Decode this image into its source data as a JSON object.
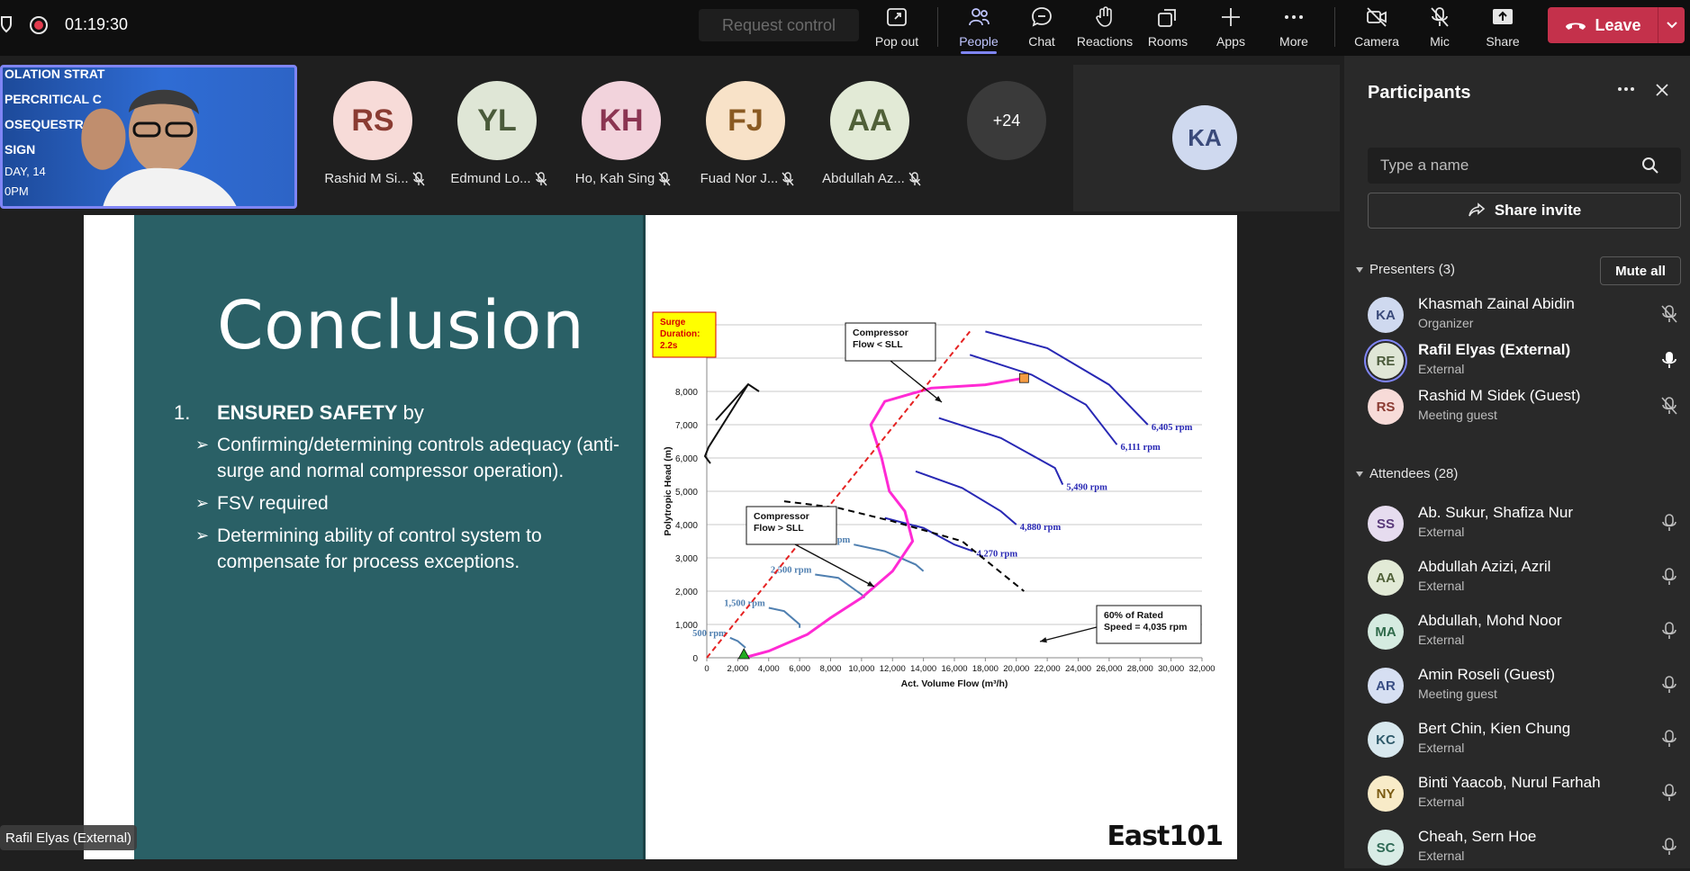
{
  "toolbar": {
    "timer": "01:19:30",
    "request_control": "Request control",
    "buttons": {
      "pop_out": "Pop out",
      "people": "People",
      "chat": "Chat",
      "reactions": "Reactions",
      "rooms": "Rooms",
      "apps": "Apps",
      "more": "More",
      "camera": "Camera",
      "mic": "Mic",
      "share": "Share"
    },
    "leave": "Leave"
  },
  "gallery": {
    "tiles": [
      {
        "initials": "RS",
        "name": "Rashid M Si...",
        "bg": "#f7dbd8",
        "fg": "#8a3b32"
      },
      {
        "initials": "YL",
        "name": "Edmund Lo...",
        "bg": "#dfe6d6",
        "fg": "#4a5a3a"
      },
      {
        "initials": "KH",
        "name": "Ho, Kah Sing",
        "bg": "#f2d3dc",
        "fg": "#8b3552"
      },
      {
        "initials": "FJ",
        "name": "Fuad Nor J...",
        "bg": "#f8e2c8",
        "fg": "#8a5a22"
      },
      {
        "initials": "AA",
        "name": "Abdullah Az...",
        "bg": "#e2ead6",
        "fg": "#506038"
      }
    ],
    "overflow": "+24",
    "speaker_tile_initials": "KA"
  },
  "slide": {
    "title": "Conclusion",
    "item_number": "1.",
    "item_heading": "ENSURED SAFETY",
    "item_heading_suffix": " by",
    "subitems": [
      "Confirming/determining controls adequacy (anti-surge and normal compressor operation).",
      "FSV required",
      "Determining ability of control system to compensate for process exceptions."
    ],
    "brand": "East101"
  },
  "chart_data": {
    "type": "line",
    "title": "",
    "xlabel": "Act. Volume Flow (m³/h)",
    "ylabel": "Polytropic Head (m)",
    "xlim": [
      0,
      32000
    ],
    "ylim": [
      0,
      10000
    ],
    "x_ticks": [
      "0",
      "2,000",
      "4,000",
      "6,000",
      "8,000",
      "10,000",
      "12,000",
      "14,000",
      "16,000",
      "18,000",
      "20,000",
      "22,000",
      "24,000",
      "26,000",
      "28,000",
      "30,000",
      "32,000"
    ],
    "y_ticks": [
      "0",
      "1,000",
      "2,000",
      "3,000",
      "4,000",
      "5,000",
      "6,000",
      "7,000",
      "8,000"
    ],
    "grid": true,
    "series": [
      {
        "name": "6,405 rpm",
        "color": "#2828b4",
        "points": [
          [
            18000,
            9800
          ],
          [
            22000,
            9300
          ],
          [
            26000,
            8200
          ],
          [
            28500,
            7000
          ]
        ]
      },
      {
        "name": "6,111 rpm",
        "color": "#2828b4",
        "points": [
          [
            17000,
            9100
          ],
          [
            21000,
            8500
          ],
          [
            24500,
            7600
          ],
          [
            26500,
            6400
          ]
        ]
      },
      {
        "name": "5,490 rpm",
        "color": "#2828b4",
        "points": [
          [
            15000,
            7200
          ],
          [
            19000,
            6600
          ],
          [
            22500,
            5700
          ],
          [
            23000,
            5200
          ]
        ]
      },
      {
        "name": "4,880 rpm",
        "color": "#2828b4",
        "points": [
          [
            13500,
            5600
          ],
          [
            16500,
            5100
          ],
          [
            19000,
            4400
          ],
          [
            20000,
            4000
          ]
        ]
      },
      {
        "name": "4,270 rpm",
        "color": "#2828b4",
        "points": [
          [
            11500,
            4200
          ],
          [
            14000,
            3900
          ],
          [
            16000,
            3400
          ],
          [
            17200,
            3200
          ]
        ]
      },
      {
        "name": "3,500 rpm",
        "color": "#4f7fb0",
        "points": [
          [
            9500,
            3400
          ],
          [
            11500,
            3200
          ],
          [
            13500,
            2800
          ],
          [
            14000,
            2600
          ]
        ]
      },
      {
        "name": "2,500 rpm",
        "color": "#4f7fb0",
        "points": [
          [
            7000,
            2500
          ],
          [
            8500,
            2400
          ],
          [
            10000,
            1900
          ],
          [
            10200,
            1800
          ]
        ]
      },
      {
        "name": "1,500 rpm",
        "color": "#4f7fb0",
        "points": [
          [
            4000,
            1500
          ],
          [
            5000,
            1400
          ],
          [
            6000,
            1000
          ],
          [
            6000,
            900
          ]
        ]
      },
      {
        "name": "500 rpm",
        "color": "#4f7fb0",
        "points": [
          [
            1500,
            600
          ],
          [
            2000,
            500
          ],
          [
            2500,
            300
          ]
        ]
      },
      {
        "name": "",
        "color": "#ff2ad4",
        "points": [
          [
            2400,
            0
          ],
          [
            4000,
            200
          ],
          [
            6500,
            700
          ],
          [
            8000,
            1200
          ],
          [
            10000,
            1800
          ],
          [
            12000,
            2600
          ],
          [
            13300,
            3500
          ],
          [
            12800,
            4400
          ],
          [
            11800,
            5000
          ],
          [
            11300,
            6000
          ],
          [
            10600,
            7000
          ],
          [
            11500,
            7700
          ],
          [
            14500,
            8100
          ],
          [
            18000,
            8200
          ],
          [
            20500,
            8400
          ]
        ]
      },
      {
        "name": "",
        "color": "#e52222",
        "dashed": true,
        "points": [
          [
            0,
            0
          ],
          [
            17000,
            9800
          ]
        ]
      },
      {
        "name": "",
        "color": "#000000",
        "dashed": true,
        "points": [
          [
            5000,
            4700
          ],
          [
            8500,
            4500
          ],
          [
            12000,
            4100
          ],
          [
            16500,
            3500
          ],
          [
            20500,
            2000
          ]
        ]
      }
    ],
    "markers": [
      {
        "x": 2400,
        "y": 0,
        "shape": "triangle",
        "color": "#22aa22"
      },
      {
        "x": 20500,
        "y": 8400,
        "shape": "square",
        "color": "#f59b42"
      }
    ],
    "annotations": [
      {
        "text": [
          "Surge",
          "Duration:",
          "2.2s"
        ],
        "style": "yellow"
      },
      {
        "text": [
          "Compressor",
          "Flow < SLL"
        ]
      },
      {
        "text": [
          "Compressor",
          "Flow > SLL"
        ]
      },
      {
        "text": [
          "60% of Rated",
          "Speed = 4,035 rpm"
        ]
      }
    ]
  },
  "speaker_name": "Rafil Elyas (External)",
  "panel": {
    "title": "Participants",
    "search_placeholder": "Type a name",
    "share_invite": "Share invite",
    "presenters_head": "Presenters (3)",
    "mute_all": "Mute all",
    "attendees_head": "Attendees (28)",
    "presenters": [
      {
        "initials": "KA",
        "name": "Khasmah Zainal Abidin",
        "role": "Organizer",
        "bg": "#cfd9ef",
        "fg": "#3a4a7a",
        "mic": "muted"
      },
      {
        "initials": "RE",
        "name": "Rafil Elyas (External)",
        "role": "External",
        "bg": "#dfe6d6",
        "fg": "#4a5a3a",
        "mic": "on",
        "bold": true
      },
      {
        "initials": "RS",
        "name": "Rashid M Sidek (Guest)",
        "role": "Meeting guest",
        "bg": "#f7dbd8",
        "fg": "#8a3b32",
        "mic": "muted"
      }
    ],
    "attendees": [
      {
        "initials": "SS",
        "name": "Ab. Sukur, Shafiza Nur",
        "role": "External",
        "bg": "#e6dcef",
        "fg": "#5a3a7a"
      },
      {
        "initials": "AA",
        "name": "Abdullah Azizi, Azril",
        "role": "External",
        "bg": "#e2ead6",
        "fg": "#506038"
      },
      {
        "initials": "MA",
        "name": "Abdullah, Mohd Noor",
        "role": "External",
        "bg": "#d5ebe0",
        "fg": "#2f6a4a"
      },
      {
        "initials": "AR",
        "name": "Amin Roseli (Guest)",
        "role": "Meeting guest",
        "bg": "#d6dff2",
        "fg": "#384d84"
      },
      {
        "initials": "KC",
        "name": "Bert Chin, Kien Chung",
        "role": "External",
        "bg": "#d8e8ee",
        "fg": "#2f5a6a"
      },
      {
        "initials": "NY",
        "name": "Binti Yaacob, Nurul Farhah",
        "role": "External",
        "bg": "#f8ebc8",
        "fg": "#7a5a12"
      },
      {
        "initials": "SC",
        "name": "Cheah, Sern Hoe",
        "role": "External",
        "bg": "#d9ece6",
        "fg": "#2f6a56"
      }
    ]
  }
}
